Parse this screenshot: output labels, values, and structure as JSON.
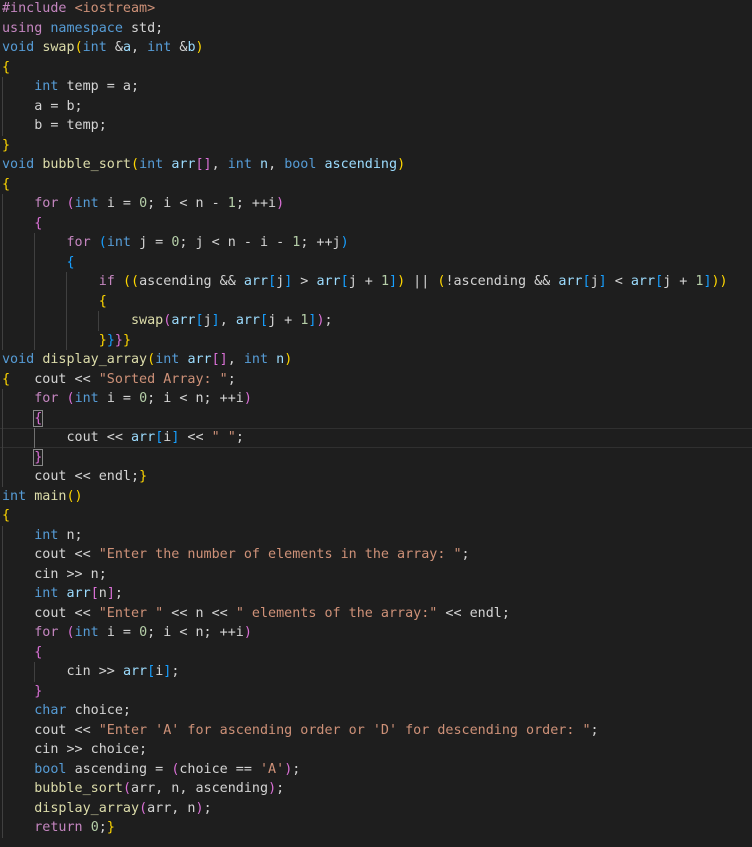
{
  "editor": {
    "language": "cpp",
    "theme_colors": {
      "background": "#1e1e1e",
      "keyword": "#569cd6",
      "control": "#c586c0",
      "function": "#dcdcaa",
      "variable": "#9cdcfe",
      "number": "#b5cea8",
      "string": "#ce9178",
      "bracket_1": "#ffd700",
      "bracket_2": "#da70d6",
      "bracket_3": "#179fff"
    },
    "cursor_line": 22,
    "lines": [
      [
        [
          "ctl",
          "#include "
        ],
        [
          "str",
          "<iostream>"
        ]
      ],
      [
        [
          "ctl",
          "using "
        ],
        [
          "kw",
          "namespace "
        ],
        [
          "op",
          "std;"
        ]
      ],
      [
        [
          "kw",
          "void "
        ],
        [
          "fn",
          "swap"
        ],
        [
          "b1",
          "("
        ],
        [
          "kw",
          "int "
        ],
        [
          "op",
          "&"
        ],
        [
          "var",
          "a"
        ],
        [
          "op",
          ", "
        ],
        [
          "kw",
          "int "
        ],
        [
          "op",
          "&"
        ],
        [
          "var",
          "b"
        ],
        [
          "b1",
          ")"
        ]
      ],
      [
        [
          "b1",
          "{"
        ]
      ],
      [
        [
          "op",
          "    "
        ],
        [
          "kw",
          "int "
        ],
        [
          "op",
          "temp = a;"
        ]
      ],
      [
        [
          "op",
          "    a = b;"
        ]
      ],
      [
        [
          "op",
          "    b = temp;"
        ]
      ],
      [
        [
          "b1",
          "}"
        ]
      ],
      [
        [
          "kw",
          "void "
        ],
        [
          "fn",
          "bubble_sort"
        ],
        [
          "b1",
          "("
        ],
        [
          "kw",
          "int "
        ],
        [
          "var",
          "arr"
        ],
        [
          "b2",
          "[]"
        ],
        [
          "op",
          ", "
        ],
        [
          "kw",
          "int "
        ],
        [
          "var",
          "n"
        ],
        [
          "op",
          ", "
        ],
        [
          "kw",
          "bool "
        ],
        [
          "var",
          "ascending"
        ],
        [
          "b1",
          ")"
        ]
      ],
      [
        [
          "b1",
          "{"
        ]
      ],
      [
        [
          "op",
          "    "
        ],
        [
          "ctl",
          "for "
        ],
        [
          "b2",
          "("
        ],
        [
          "kw",
          "int "
        ],
        [
          "op",
          "i = "
        ],
        [
          "num",
          "0"
        ],
        [
          "op",
          "; i < n - "
        ],
        [
          "num",
          "1"
        ],
        [
          "op",
          "; ++i"
        ],
        [
          "b2",
          ")"
        ]
      ],
      [
        [
          "op",
          "    "
        ],
        [
          "b2",
          "{"
        ]
      ],
      [
        [
          "op",
          "        "
        ],
        [
          "ctl",
          "for "
        ],
        [
          "b3",
          "("
        ],
        [
          "kw",
          "int "
        ],
        [
          "op",
          "j = "
        ],
        [
          "num",
          "0"
        ],
        [
          "op",
          "; j < n - i - "
        ],
        [
          "num",
          "1"
        ],
        [
          "op",
          "; ++j"
        ],
        [
          "b3",
          ")"
        ]
      ],
      [
        [
          "op",
          "        "
        ],
        [
          "b3",
          "{"
        ]
      ],
      [
        [
          "op",
          "            "
        ],
        [
          "ctl",
          "if "
        ],
        [
          "b1",
          "(("
        ],
        [
          "op",
          "ascending && "
        ],
        [
          "var",
          "arr"
        ],
        [
          "b3",
          "["
        ],
        [
          "op",
          "j"
        ],
        [
          "b3",
          "]"
        ],
        [
          "op",
          " > "
        ],
        [
          "var",
          "arr"
        ],
        [
          "b3",
          "["
        ],
        [
          "op",
          "j + "
        ],
        [
          "num",
          "1"
        ],
        [
          "b3",
          "]"
        ],
        [
          "b1",
          ")"
        ],
        [
          "op",
          " || "
        ],
        [
          "b1",
          "("
        ],
        [
          "op",
          "!ascending && "
        ],
        [
          "var",
          "arr"
        ],
        [
          "b3",
          "["
        ],
        [
          "op",
          "j"
        ],
        [
          "b3",
          "]"
        ],
        [
          "op",
          " < "
        ],
        [
          "var",
          "arr"
        ],
        [
          "b3",
          "["
        ],
        [
          "op",
          "j + "
        ],
        [
          "num",
          "1"
        ],
        [
          "b3",
          "]"
        ],
        [
          "b1",
          "))"
        ]
      ],
      [
        [
          "op",
          "            "
        ],
        [
          "b1",
          "{"
        ]
      ],
      [
        [
          "op",
          "                "
        ],
        [
          "fn",
          "swap"
        ],
        [
          "b2",
          "("
        ],
        [
          "var",
          "arr"
        ],
        [
          "b3",
          "["
        ],
        [
          "op",
          "j"
        ],
        [
          "b3",
          "]"
        ],
        [
          "op",
          ", "
        ],
        [
          "var",
          "arr"
        ],
        [
          "b3",
          "["
        ],
        [
          "op",
          "j + "
        ],
        [
          "num",
          "1"
        ],
        [
          "b3",
          "]"
        ],
        [
          "b2",
          ")"
        ],
        [
          "op",
          ";"
        ]
      ],
      [
        [
          "op",
          "            "
        ],
        [
          "b1",
          "}"
        ],
        [
          "b3",
          "}"
        ],
        [
          "b2",
          "}"
        ],
        [
          "b1",
          "}"
        ]
      ],
      [
        [
          "kw",
          "void "
        ],
        [
          "fn",
          "display_array"
        ],
        [
          "b1",
          "("
        ],
        [
          "kw",
          "int "
        ],
        [
          "var",
          "arr"
        ],
        [
          "b2",
          "[]"
        ],
        [
          "op",
          ", "
        ],
        [
          "kw",
          "int "
        ],
        [
          "var",
          "n"
        ],
        [
          "b1",
          ")"
        ]
      ],
      [
        [
          "b1",
          "{"
        ],
        [
          "op",
          "   cout << "
        ],
        [
          "str",
          "\"Sorted Array: \""
        ],
        [
          "op",
          ";"
        ]
      ],
      [
        [
          "op",
          "    "
        ],
        [
          "ctl",
          "for "
        ],
        [
          "b2",
          "("
        ],
        [
          "kw",
          "int "
        ],
        [
          "op",
          "i = "
        ],
        [
          "num",
          "0"
        ],
        [
          "op",
          "; i < n; ++i"
        ],
        [
          "b2",
          ")"
        ]
      ],
      [
        [
          "op",
          "    "
        ],
        [
          "b2",
          "{"
        ]
      ],
      [
        [
          "op",
          "        cout << "
        ],
        [
          "var",
          "arr"
        ],
        [
          "b3",
          "["
        ],
        [
          "op",
          "i"
        ],
        [
          "b3",
          "]"
        ],
        [
          "op",
          " << "
        ],
        [
          "str",
          "\" \""
        ],
        [
          "op",
          ";"
        ]
      ],
      [
        [
          "op",
          "    "
        ],
        [
          "b2",
          "}"
        ]
      ],
      [
        [
          "op",
          "    cout << endl;"
        ],
        [
          "b1",
          "}"
        ]
      ],
      [
        [
          "kw",
          "int "
        ],
        [
          "fn",
          "main"
        ],
        [
          "b1",
          "()"
        ]
      ],
      [
        [
          "b1",
          "{"
        ]
      ],
      [
        [
          "op",
          "    "
        ],
        [
          "kw",
          "int "
        ],
        [
          "op",
          "n;"
        ]
      ],
      [
        [
          "op",
          "    cout << "
        ],
        [
          "str",
          "\"Enter the number of elements in the array: \""
        ],
        [
          "op",
          ";"
        ]
      ],
      [
        [
          "op",
          "    cin >> n;"
        ]
      ],
      [
        [
          "op",
          "    "
        ],
        [
          "kw",
          "int "
        ],
        [
          "var",
          "arr"
        ],
        [
          "b2",
          "["
        ],
        [
          "op",
          "n"
        ],
        [
          "b2",
          "]"
        ],
        [
          "op",
          ";"
        ]
      ],
      [
        [
          "op",
          "    cout << "
        ],
        [
          "str",
          "\"Enter \""
        ],
        [
          "op",
          " << n << "
        ],
        [
          "str",
          "\" elements of the array:\""
        ],
        [
          "op",
          " << endl;"
        ]
      ],
      [
        [
          "op",
          "    "
        ],
        [
          "ctl",
          "for "
        ],
        [
          "b2",
          "("
        ],
        [
          "kw",
          "int "
        ],
        [
          "op",
          "i = "
        ],
        [
          "num",
          "0"
        ],
        [
          "op",
          "; i < n; ++i"
        ],
        [
          "b2",
          ")"
        ]
      ],
      [
        [
          "op",
          "    "
        ],
        [
          "b2",
          "{"
        ]
      ],
      [
        [
          "op",
          "        cin >> "
        ],
        [
          "var",
          "arr"
        ],
        [
          "b3",
          "["
        ],
        [
          "op",
          "i"
        ],
        [
          "b3",
          "]"
        ],
        [
          "op",
          ";"
        ]
      ],
      [
        [
          "op",
          "    "
        ],
        [
          "b2",
          "}"
        ]
      ],
      [
        [
          "op",
          "    "
        ],
        [
          "kw",
          "char "
        ],
        [
          "op",
          "choice;"
        ]
      ],
      [
        [
          "op",
          "    cout << "
        ],
        [
          "str",
          "\"Enter 'A' for ascending order or 'D' for descending order: \""
        ],
        [
          "op",
          ";"
        ]
      ],
      [
        [
          "op",
          "    cin >> choice;"
        ]
      ],
      [
        [
          "op",
          "    "
        ],
        [
          "kw",
          "bool "
        ],
        [
          "op",
          "ascending = "
        ],
        [
          "b2",
          "("
        ],
        [
          "op",
          "choice == "
        ],
        [
          "str",
          "'A'"
        ],
        [
          "b2",
          ")"
        ],
        [
          "op",
          ";"
        ]
      ],
      [
        [
          "op",
          "    "
        ],
        [
          "fn",
          "bubble_sort"
        ],
        [
          "b2",
          "("
        ],
        [
          "op",
          "arr, n, ascending"
        ],
        [
          "b2",
          ")"
        ],
        [
          "op",
          ";"
        ]
      ],
      [
        [
          "op",
          "    "
        ],
        [
          "fn",
          "display_array"
        ],
        [
          "b2",
          "("
        ],
        [
          "op",
          "arr, n"
        ],
        [
          "b2",
          ")"
        ],
        [
          "op",
          ";"
        ]
      ],
      [
        [
          "op",
          "    "
        ],
        [
          "ctl",
          "return "
        ],
        [
          "num",
          "0"
        ],
        [
          "op",
          ";"
        ],
        [
          "b1",
          "}"
        ]
      ]
    ]
  }
}
